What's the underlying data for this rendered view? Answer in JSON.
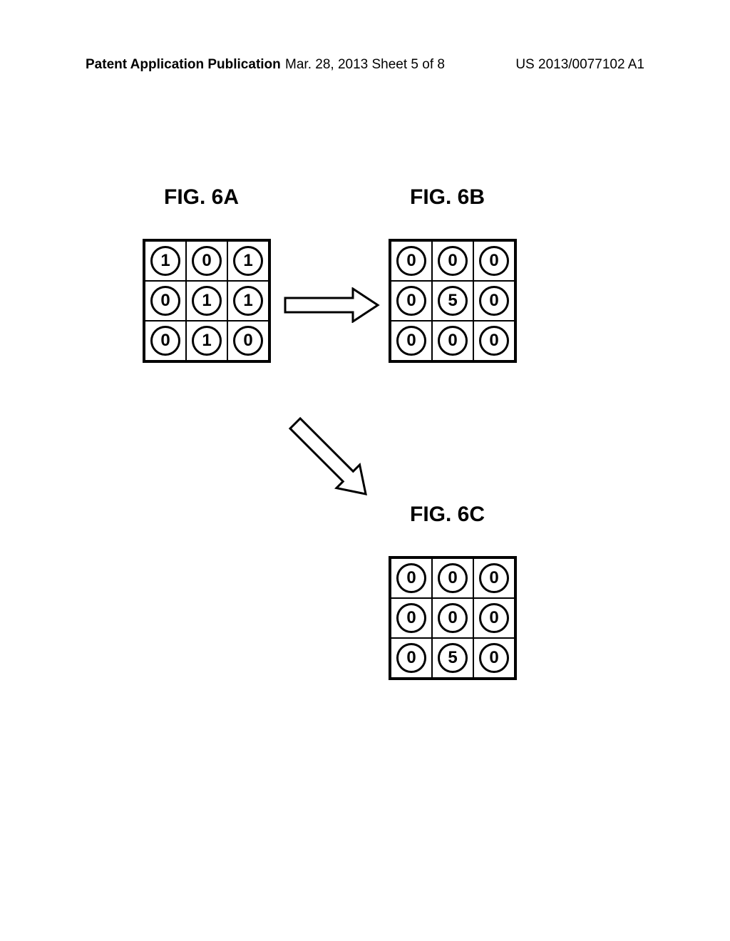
{
  "header": {
    "left": "Patent Application Publication",
    "center": "Mar. 28, 2013  Sheet 5 of 8",
    "right": "US 2013/0077102 A1"
  },
  "figures": {
    "a": {
      "label": "FIG. 6A",
      "grid": [
        [
          1,
          0,
          1
        ],
        [
          0,
          1,
          1
        ],
        [
          0,
          1,
          0
        ]
      ]
    },
    "b": {
      "label": "FIG. 6B",
      "grid": [
        [
          0,
          0,
          0
        ],
        [
          0,
          5,
          0
        ],
        [
          0,
          0,
          0
        ]
      ]
    },
    "c": {
      "label": "FIG. 6C",
      "grid": [
        [
          0,
          0,
          0
        ],
        [
          0,
          0,
          0
        ],
        [
          0,
          5,
          0
        ]
      ]
    }
  },
  "chart_data": {
    "type": "table",
    "title": "Patent drawing FIG. 6A-6C: 3x3 matrix value transformation",
    "matrices": [
      {
        "name": "FIG. 6A",
        "rows": 3,
        "cols": 3,
        "values": [
          [
            1,
            0,
            1
          ],
          [
            0,
            1,
            1
          ],
          [
            0,
            1,
            0
          ]
        ]
      },
      {
        "name": "FIG. 6B",
        "rows": 3,
        "cols": 3,
        "values": [
          [
            0,
            0,
            0
          ],
          [
            0,
            5,
            0
          ],
          [
            0,
            0,
            0
          ]
        ]
      },
      {
        "name": "FIG. 6C",
        "rows": 3,
        "cols": 3,
        "values": [
          [
            0,
            0,
            0
          ],
          [
            0,
            0,
            0
          ],
          [
            0,
            5,
            0
          ]
        ]
      }
    ],
    "arrows": [
      {
        "from": "FIG. 6A",
        "to": "FIG. 6B",
        "direction": "right"
      },
      {
        "from": "FIG. 6A",
        "to": "FIG. 6C",
        "direction": "down-right"
      }
    ]
  }
}
